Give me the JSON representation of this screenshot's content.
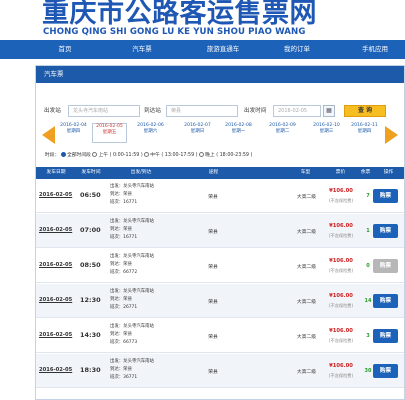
{
  "header": {
    "title": "重庆市公路客运售票网",
    "subtitle": "CHONG QING SHI GONG LU KE YUN SHOU PIAO WANG"
  },
  "nav": {
    "items": [
      {
        "label": "首页"
      },
      {
        "label": "汽车票"
      },
      {
        "label": "旅游直通车"
      },
      {
        "label": "我的订单"
      },
      {
        "label": "手机应用"
      }
    ]
  },
  "panel": {
    "title": "汽车票"
  },
  "search": {
    "from_label": "出发站",
    "from_value": "龙头寺汽车南站",
    "to_label": "到达站",
    "to_value": "荣县",
    "date_label": "出发时间",
    "date_value": "2016-02-05",
    "query_label": "查 询"
  },
  "date_tabs": [
    {
      "date": "2016-02-04",
      "weekday": "星期四",
      "active": false
    },
    {
      "date": "2016-02-05",
      "weekday": "星期五",
      "active": true
    },
    {
      "date": "2016-02-06",
      "weekday": "星期六",
      "active": false
    },
    {
      "date": "2016-02-07",
      "weekday": "星期日",
      "active": false
    },
    {
      "date": "2016-02-08",
      "weekday": "星期一",
      "active": false
    },
    {
      "date": "2016-02-09",
      "weekday": "星期二",
      "active": false
    },
    {
      "date": "2016-02-10",
      "weekday": "星期三",
      "active": false
    },
    {
      "date": "2016-02-11",
      "weekday": "星期四",
      "active": false
    }
  ],
  "filter": {
    "label": "时段：",
    "options": [
      {
        "label": "全部时间段",
        "checked": true
      },
      {
        "label": "上午 ( 0:00-11:59 )",
        "checked": false
      },
      {
        "label": "中午 ( 13:00-17:59 )",
        "checked": false
      },
      {
        "label": "晚上 ( 18:00-23:59 )",
        "checked": false
      }
    ]
  },
  "table": {
    "headers": [
      "发车日期",
      "发车时间",
      "出发/到达",
      "途程",
      "车型",
      "票价",
      "余票",
      "操作"
    ],
    "rows": [
      {
        "date": "2016-02-05",
        "time": "06:50",
        "depart": "出发：龙头寺汽车南站",
        "arrive": "到达：荣县",
        "bus_no": "班次：16771",
        "dest": "荣县",
        "type": "大高二级",
        "price": "¥106.00",
        "note": "(不含保险费)",
        "left": "7",
        "buy": "购票",
        "disabled": false
      },
      {
        "date": "2016-02-05",
        "time": "07:00",
        "depart": "出发：龙头寺汽车南站",
        "arrive": "到达：荣县",
        "bus_no": "班次：16771",
        "dest": "荣县",
        "type": "大高二级",
        "price": "¥106.00",
        "note": "(不含保险费)",
        "left": "1",
        "buy": "购票",
        "disabled": false
      },
      {
        "date": "2016-02-05",
        "time": "08:50",
        "depart": "出发：龙头寺汽车南站",
        "arrive": "到达：荣县",
        "bus_no": "班次：66772",
        "dest": "荣县",
        "type": "大高二级",
        "price": "¥106.00",
        "note": "(不含保险费)",
        "left": "0",
        "buy": "购票",
        "disabled": true
      },
      {
        "date": "2016-02-05",
        "time": "12:30",
        "depart": "出发：龙头寺汽车南站",
        "arrive": "到达：荣县",
        "bus_no": "班次：26771",
        "dest": "荣县",
        "type": "大高二级",
        "price": "¥106.00",
        "note": "(不含保险费)",
        "left": "14",
        "buy": "购票",
        "disabled": false
      },
      {
        "date": "2016-02-05",
        "time": "14:30",
        "depart": "出发：龙头寺汽车南站",
        "arrive": "到达：荣县",
        "bus_no": "班次：66773",
        "dest": "荣县",
        "type": "大高二级",
        "price": "¥106.00",
        "note": "(不含保险费)",
        "left": "3",
        "buy": "购票",
        "disabled": false
      },
      {
        "date": "2016-02-05",
        "time": "18:30",
        "depart": "出发：龙头寺汽车南站",
        "arrive": "到达：荣县",
        "bus_no": "班次：36771",
        "dest": "荣县",
        "type": "大高二级",
        "price": "¥106.00",
        "note": "(不含保险费)",
        "left": "30",
        "buy": "购票",
        "disabled": false
      }
    ]
  }
}
